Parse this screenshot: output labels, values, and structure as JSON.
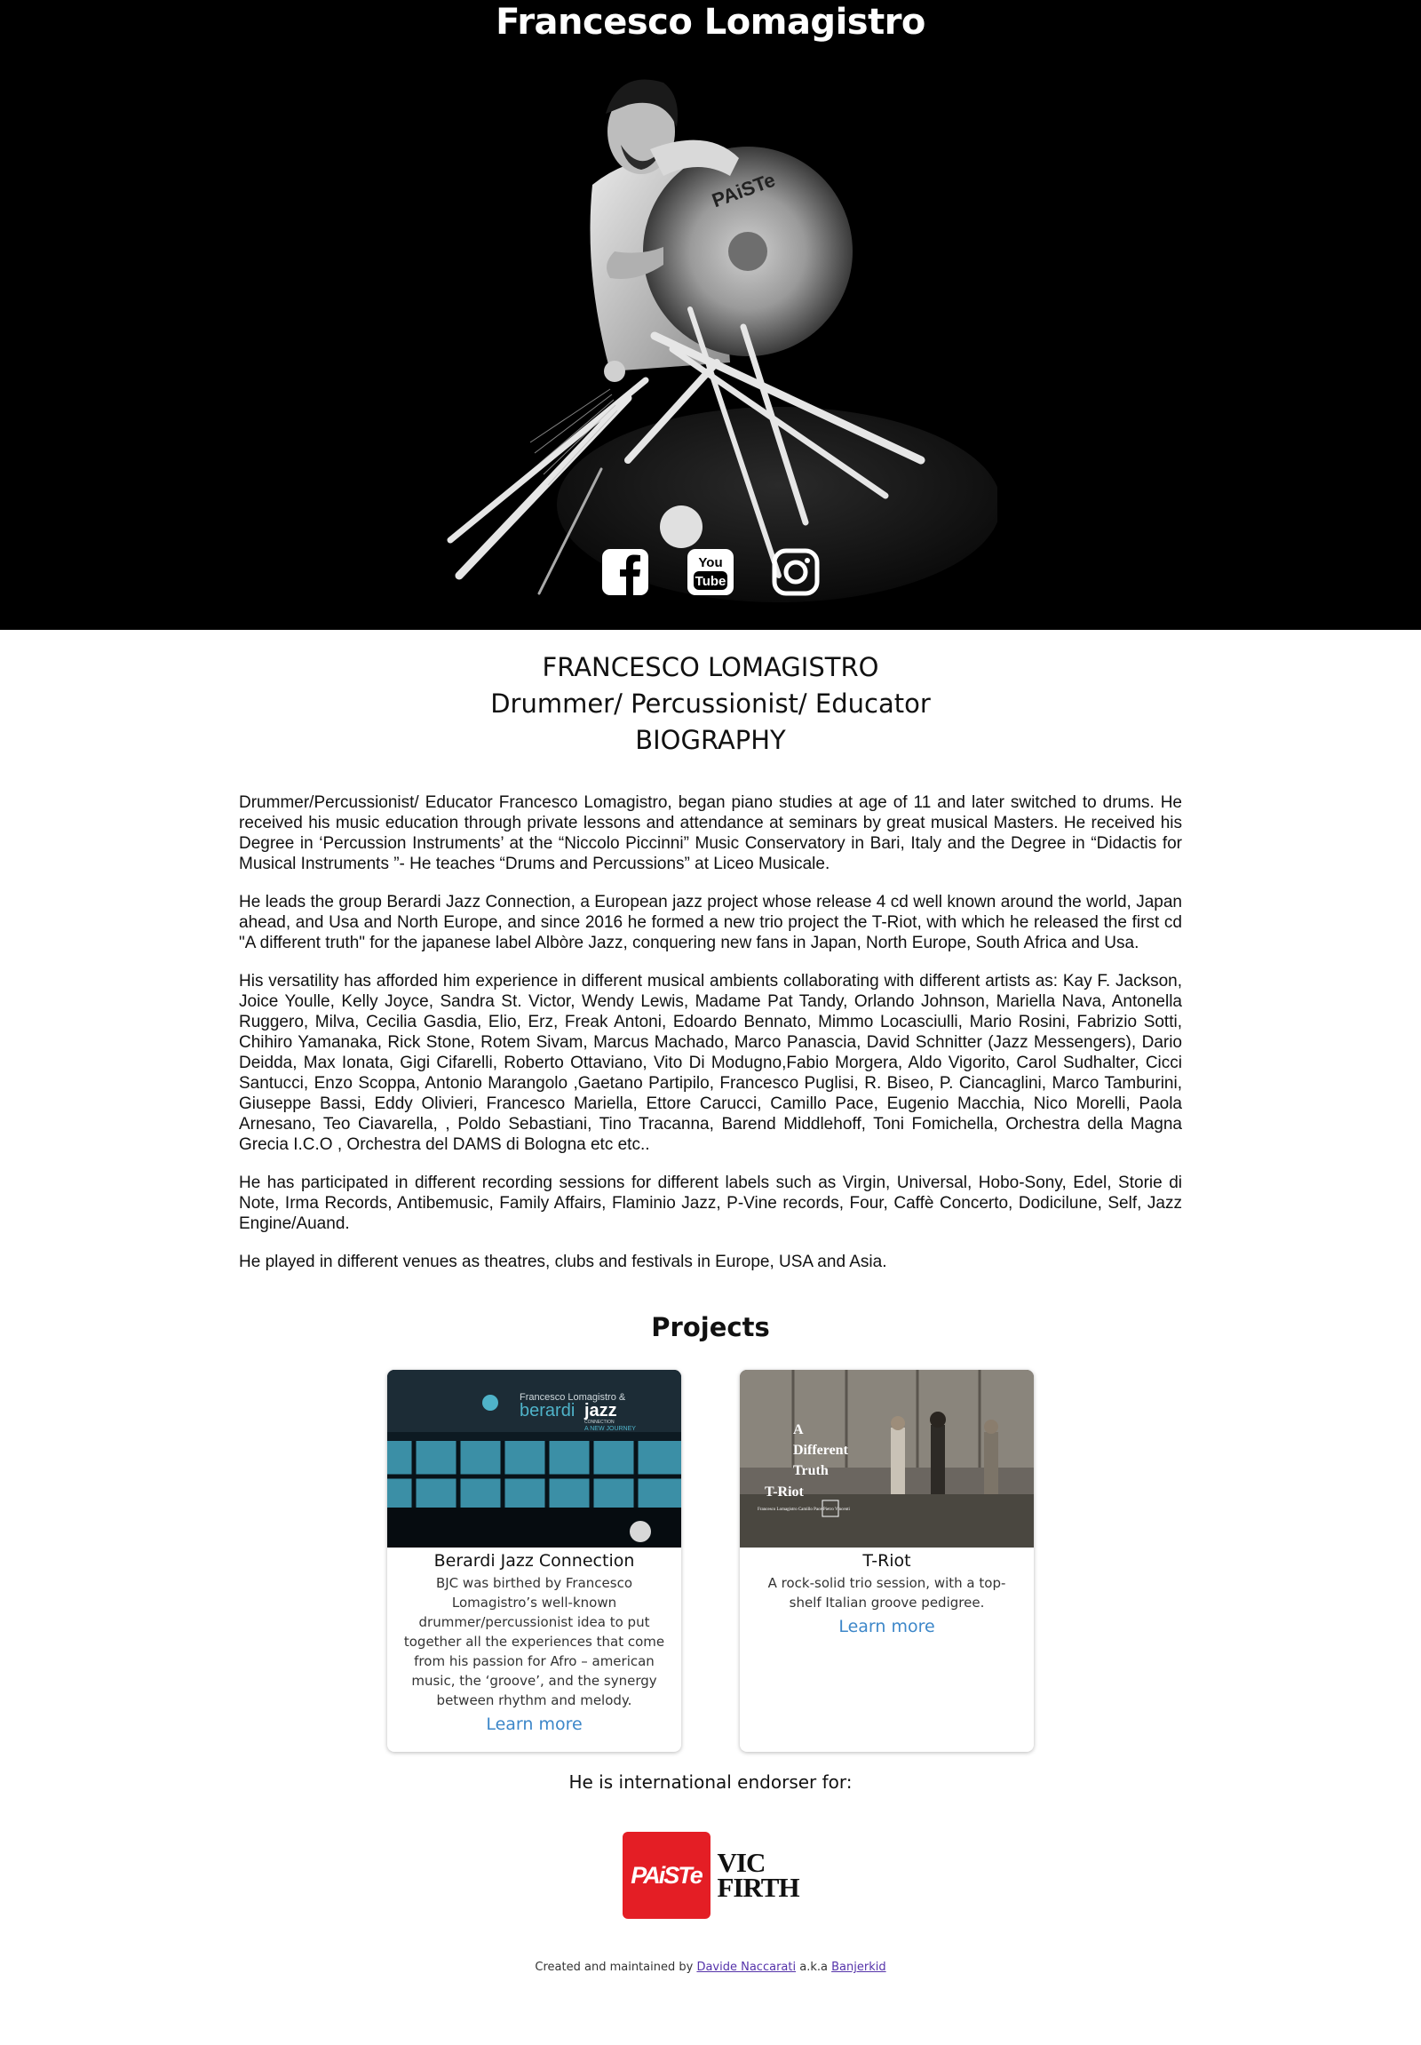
{
  "hero": {
    "title": "Francesco Lomagistro",
    "photo_alt": "drummer-portrait",
    "social": [
      {
        "name": "facebook-icon"
      },
      {
        "name": "youtube-icon",
        "glyph_top": "You",
        "glyph_bottom": "Tube"
      },
      {
        "name": "instagram-icon"
      }
    ]
  },
  "bio_header": {
    "name": "FRANCESCO LOMAGISTRO",
    "role": "Drummer/ Percussionist/ Educator",
    "section": "BIOGRAPHY"
  },
  "bio": {
    "paragraphs": [
      "Drummer/Percussionist/ Educator Francesco Lomagistro, began piano studies at age of 11 and later switched to drums. He received his music education through private lessons and attendance at seminars by great musical Masters. He received his Degree in ‘Percussion Instruments’ at the “Niccolo Piccinni” Music Conservatory in Bari, Italy and the Degree in “Didactis for Musical Instruments ”- He teaches “Drums and Percussions” at Liceo Musicale.",
      "He leads the group Berardi Jazz Connection, a European jazz project whose release 4 cd well known around the world, Japan ahead, and Usa and North Europe, and since 2016 he formed a new trio project the T-Riot, with which he released the first cd \"A different truth\" for the japanese label Albòre Jazz, conquering new fans in Japan, North Europe, South Africa and Usa.",
      "His versatility has afforded him experience in different musical ambients collaborating with different artists as: Kay F. Jackson, Joice Youlle, Kelly Joyce, Sandra St. Victor, Wendy Lewis, Madame Pat Tandy, Orlando Johnson, Mariella Nava, Antonella Ruggero, Milva, Cecilia Gasdia, Elio, Erz, Freak Antoni, Edoardo Bennato, Mimmo Locasciulli, Mario Rosini, Fabrizio Sotti, Chihiro Yamanaka, Rick Stone, Rotem Sivam, Marcus Machado, Marco Panascia, David Schnitter (Jazz Messengers), Dario Deidda, Max Ionata, Gigi Cifarelli, Roberto Ottaviano, Vito Di Modugno,Fabio Morgera, Aldo Vigorito, Carol Sudhalter, Cicci Santucci, Enzo Scoppa, Antonio Marangolo ,Gaetano Partipilo, Francesco Puglisi, R. Biseo, P. Ciancaglini, Marco Tamburini, Giuseppe Bassi, Eddy Olivieri, Francesco Mariella, Ettore Carucci, Camillo Pace, Eugenio Macchia, Nico Morelli, Paola Arnesano, Teo Ciavarella, , Poldo Sebastiani, Tino Tracanna, Barend Middlehoff, Toni Fomichella, Orchestra della Magna Grecia I.C.O , Orchestra del DAMS di Bologna etc etc..",
      "He has participated in different recording sessions for different labels such as Virgin, Universal, Hobo-Sony, Edel, Storie di Note, Irma Records, Antibemusic, Family Affairs, Flaminio Jazz, P-Vine records, Four, Caffè Concerto, Dodicilune, Self, Jazz Engine/Auand.",
      "He played in different venues as theatres, clubs and festivals in Europe, USA and Asia."
    ]
  },
  "projects": {
    "title": "Projects",
    "items": [
      {
        "title": "Berardi Jazz Connection",
        "description": "BJC was birthed by Francesco Lomagistro’s well-known drummer/percussionist idea to put together all the experiences that come from his passion for Afro – american music, the ‘groove’, and the synergy between rhythm and melody.",
        "link": "Learn more",
        "cover_line1": "Francesco Lomagistro &",
        "cover_line2a": "berardi",
        "cover_line2b": "jazz",
        "cover_line3": "CONNECTION",
        "cover_line4": "A NEW JOURNEY"
      },
      {
        "title": "T-Riot",
        "description": "A rock-solid trio session, with a top-shelf Italian groove pedigree.",
        "link": "Learn more",
        "cover_line1": "A",
        "cover_line2": "Different",
        "cover_line3": "Truth",
        "cover_line4": "T-Riot",
        "cover_credits": "Francesco Lomagistro\nCamillo Pace\nPietro Vincenti"
      }
    ]
  },
  "endorser": {
    "title": "He is international endorser for:",
    "brands": [
      {
        "name": "Paiste",
        "text": "PAiSTe"
      },
      {
        "name": "Vic Firth",
        "line1": "VIC",
        "line2": "FIRTH",
        "mark": "®"
      }
    ]
  },
  "footer": {
    "prefix": "Created and maintained by",
    "author": "Davide Naccarati",
    "middle": "a.k.a",
    "alias": "Banjerkid"
  },
  "colors": {
    "hero_bg": "#000000",
    "link": "#3d87c9",
    "paiste_red": "#e41e25",
    "footer_link": "#5533aa"
  }
}
